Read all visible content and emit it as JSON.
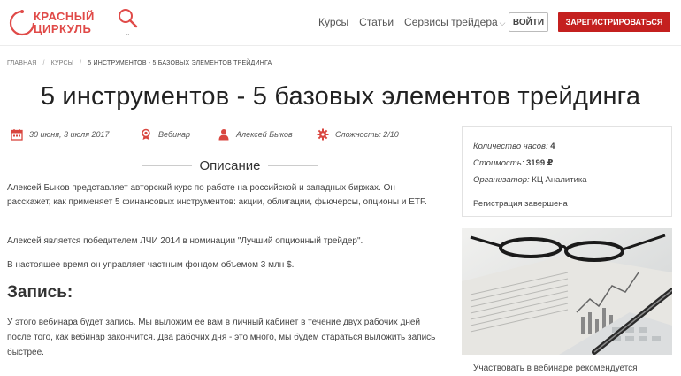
{
  "header": {
    "logo_line1": "КРАСНЫЙ",
    "logo_line2": "ЦИРКУЛЬ",
    "nav": [
      {
        "label": "Курсы"
      },
      {
        "label": "Статьи"
      },
      {
        "label": "Сервисы трейдера"
      }
    ],
    "login_label": "ВОЙТИ",
    "register_label": "ЗАРЕГИСТРИРОВАТЬСЯ",
    "accent_color": "#c4201f"
  },
  "breadcrumb": {
    "home": "ГЛАВНАЯ",
    "section": "КУРСЫ",
    "current": "5 ИНСТРУМЕНТОВ - 5 БАЗОВЫХ ЭЛЕМЕНТОВ ТРЕЙДИНГА",
    "separator": "/"
  },
  "page_title": "5 инструментов - 5 базовых элементов трейдинга",
  "meta": {
    "dates": "30 июня, 3 июля 2017",
    "format": "Вебинар",
    "author": "Алексей Быков",
    "difficulty": "Сложность: 2/10"
  },
  "description": {
    "heading": "Описание",
    "p1": "Алексей Быков представляет авторский курс по работе на российской и западных биржах. Он расскажет, как применяет 5 финансовых инструментов: акции, облигации, фьючерсы, опционы и ETF.",
    "p2": "Алексей является победителем ЛЧИ 2014 в номинации  \"Лучший опционный трейдер\".",
    "p3": "В настоящее время он  управляет частным фондом объемом 3 млн $."
  },
  "recording": {
    "heading": "Запись:",
    "text": "У этого вебинара будет запись. Мы выложим ее вам в личный кабинет в течение двух рабочих дней после того, как вебинар закончится. Два рабочих дня  - это много, мы будем стараться выложить запись быстрее."
  },
  "sidebar": {
    "hours_label": "Количество часов:",
    "hours_value": "4",
    "price_label": "Стоимость:",
    "price_value": "3199 ₽",
    "organizer_label": "Организатор:",
    "organizer_value": "КЦ Аналитика",
    "registration_status": "Регистрация завершена",
    "caption": "Участвовать в вебинаре рекомендуется"
  },
  "icons": {
    "search": "search-icon",
    "calendar": "calendar-icon",
    "webinar": "award-icon",
    "author": "person-icon",
    "difficulty": "gear-icon"
  }
}
